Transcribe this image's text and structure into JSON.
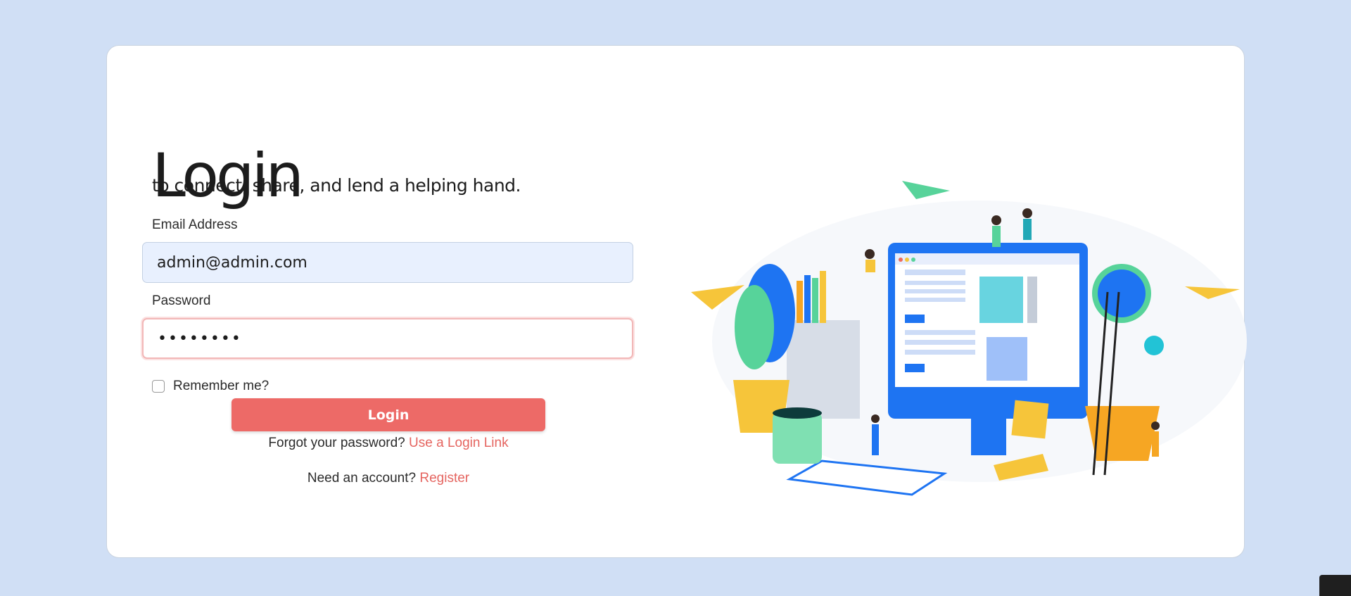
{
  "login": {
    "title": "Login",
    "subtitle": "to connect, share, and lend a helping hand.",
    "email_label": "Email Address",
    "email_value": "admin@admin.com",
    "password_label": "Password",
    "password_value": "••••••••",
    "remember_label": "Remember me?",
    "button_label": "Login",
    "forgot_text": "Forgot your password?",
    "forgot_link": "Use a Login Link",
    "account_text": "Need an account?",
    "register_link": "Register"
  },
  "colors": {
    "background": "#d0dff5",
    "accent": "#ed6a67",
    "link": "#e56560"
  },
  "icons": {
    "illustration": "computer-workspace-illustration",
    "corner": "brand-logo-icon"
  }
}
